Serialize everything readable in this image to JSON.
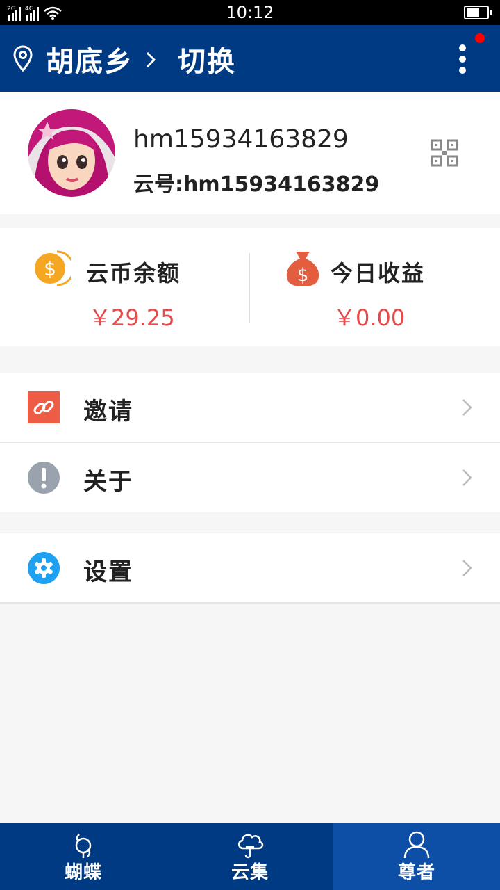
{
  "status_bar": {
    "time": "10:12",
    "network_1": "2G",
    "network_2": "4G"
  },
  "header": {
    "town": "胡底乡",
    "switch_label": "切换",
    "bg_color": "#003a82",
    "notification_dot": true
  },
  "profile": {
    "username": "hm15934163829",
    "cloud_id": "云号:hm15934163829"
  },
  "balances": {
    "coin_label": "云币余额",
    "coin_amount": "￥29.25",
    "today_label": "今日收益",
    "today_amount": "￥0.00",
    "amount_color": "#e84a4a"
  },
  "menu": {
    "invite": "邀请",
    "about": "关于",
    "settings": "设置"
  },
  "tabbar": {
    "tabs": [
      {
        "label": "蝴蝶",
        "icon": "butterfly-icon",
        "active": false
      },
      {
        "label": "云集",
        "icon": "cloud-icon",
        "active": false
      },
      {
        "label": "尊者",
        "icon": "user-icon",
        "active": true
      }
    ]
  }
}
